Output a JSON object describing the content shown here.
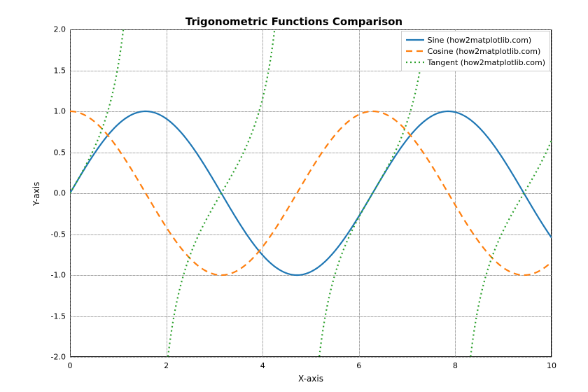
{
  "chart_data": {
    "type": "line",
    "title": "Trigonometric Functions Comparison",
    "xlabel": "X-axis",
    "ylabel": "Y-axis",
    "xlim": [
      0,
      10
    ],
    "ylim": [
      -2,
      2
    ],
    "xticks": [
      0,
      2,
      4,
      6,
      8,
      10
    ],
    "yticks": [
      -2.0,
      -1.5,
      -1.0,
      -0.5,
      0.0,
      0.5,
      1.0,
      1.5,
      2.0
    ],
    "grid": true,
    "legend_position": "upper right",
    "colors": {
      "sine": "#1f77b4",
      "cosine": "#ff7f0e",
      "tangent": "#2ca02c"
    },
    "series": [
      {
        "name": "Sine (how2matplotlib.com)",
        "style": "solid",
        "function": "sin(x)",
        "x": [
          0,
          0.5,
          1,
          1.5,
          2,
          2.5,
          3,
          3.5,
          4,
          4.5,
          5,
          5.5,
          6,
          6.5,
          7,
          7.5,
          8,
          8.5,
          9,
          9.5,
          10
        ],
        "values": [
          0.0,
          0.479,
          0.841,
          0.997,
          0.909,
          0.599,
          0.141,
          -0.351,
          -0.757,
          -0.978,
          -0.959,
          -0.706,
          -0.279,
          0.215,
          0.657,
          0.938,
          0.989,
          0.798,
          0.412,
          -0.075,
          -0.544
        ]
      },
      {
        "name": "Cosine (how2matplotlib.com)",
        "style": "dashed",
        "function": "cos(x)",
        "x": [
          0,
          0.5,
          1,
          1.5,
          2,
          2.5,
          3,
          3.5,
          4,
          4.5,
          5,
          5.5,
          6,
          6.5,
          7,
          7.5,
          8,
          8.5,
          9,
          9.5,
          10
        ],
        "values": [
          1.0,
          0.878,
          0.54,
          0.071,
          -0.416,
          -0.801,
          -0.99,
          -0.936,
          -0.654,
          -0.211,
          0.284,
          0.709,
          0.96,
          0.977,
          0.754,
          0.347,
          -0.146,
          -0.602,
          -0.911,
          -0.997,
          -0.839
        ]
      },
      {
        "name": "Tangent (how2matplotlib.com)",
        "style": "dotted",
        "function": "tan(x)",
        "asymptote_note": "clipped to ylim; asymptotes near x≈1.571, 4.712, 7.854",
        "x": [
          0,
          0.5,
          1,
          1.5,
          2,
          2.5,
          3,
          3.5,
          4,
          4.5,
          5,
          5.5,
          6,
          6.5,
          7,
          7.5,
          8,
          8.5,
          9,
          9.5,
          10
        ],
        "values": [
          0.0,
          0.546,
          1.557,
          14.101,
          -2.185,
          -0.747,
          -0.143,
          0.375,
          1.158,
          4.637,
          -3.381,
          -0.996,
          -0.291,
          0.22,
          0.871,
          2.706,
          -6.8,
          -1.326,
          -0.452,
          0.075,
          0.648
        ]
      }
    ]
  }
}
